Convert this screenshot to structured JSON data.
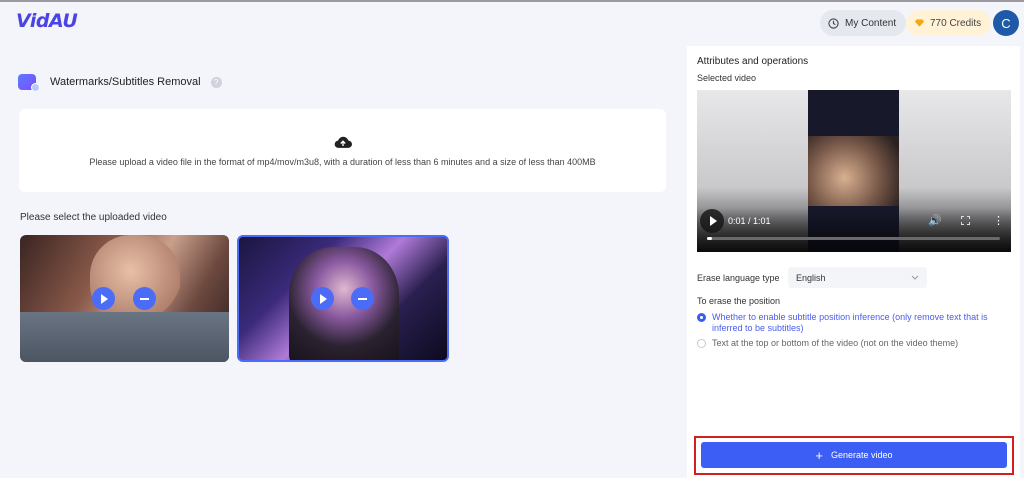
{
  "app": {
    "logo": "VidAU"
  },
  "header": {
    "my_content_label": "My Content",
    "credits_label": "770 Credits",
    "avatar_initial": "C"
  },
  "tool": {
    "title": "Watermarks/Subtitles Removal",
    "upload_hint": "Please upload a video file in the format of mp4/mov/m3u8, with a duration of less than 6 minutes and a size of less than 400MB",
    "select_label": "Please select the uploaded video",
    "videos": [
      {
        "selected": false
      },
      {
        "selected": true
      }
    ]
  },
  "panel": {
    "title": "Attributes and operations",
    "selected_video_label": "Selected video",
    "player": {
      "time": "0:01 / 1:01",
      "progress": 0.016
    },
    "erase_language_label": "Erase language type",
    "erase_language_value": "English",
    "erase_position_label": "To erase the position",
    "options": [
      {
        "label": "Whether to enable subtitle position inference (only remove text that is inferred to be subtitles)",
        "selected": true
      },
      {
        "label": "Text at the top or bottom of the video (not on the video theme)",
        "selected": false
      }
    ],
    "generate_label": "Generate video"
  },
  "colors": {
    "accent": "#3d5ef5",
    "highlight_frame": "#d21f1f",
    "logo": "#4a44e6"
  }
}
